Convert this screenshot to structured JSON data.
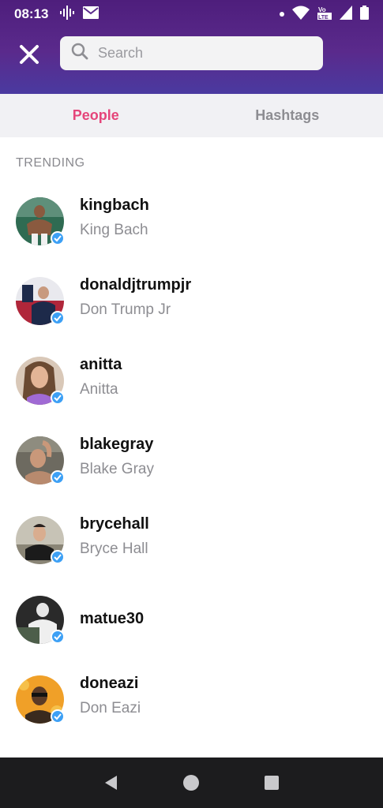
{
  "status": {
    "time": "08:13",
    "carrier_label": "Vo LTE"
  },
  "search": {
    "placeholder": "Search",
    "value": ""
  },
  "tabs": [
    {
      "label": "People",
      "active": true
    },
    {
      "label": "Hashtags",
      "active": false
    }
  ],
  "section_label": "TRENDING",
  "people": [
    {
      "username": "kingbach",
      "display_name": "King Bach",
      "verified": true
    },
    {
      "username": "donaldjtrumpjr",
      "display_name": "Don Trump Jr",
      "verified": true
    },
    {
      "username": "anitta",
      "display_name": "Anitta",
      "verified": true
    },
    {
      "username": "blakegray",
      "display_name": "Blake Gray",
      "verified": true
    },
    {
      "username": "brycehall",
      "display_name": "Bryce Hall",
      "verified": true
    },
    {
      "username": "matue30",
      "display_name": "",
      "verified": true
    },
    {
      "username": "doneazi",
      "display_name": "Don Eazi",
      "verified": true
    }
  ],
  "colors": {
    "accent": "#e5457a",
    "header": "#5a2a8c",
    "verified": "#3da0f5"
  }
}
